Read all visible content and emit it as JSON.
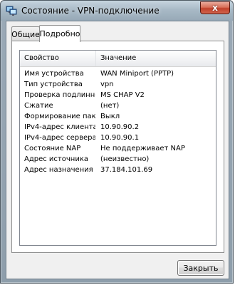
{
  "window": {
    "title": "Состояние - VPN-подключение",
    "close_glyph": "x",
    "app_icon": "network-connection-icon"
  },
  "tabs": [
    {
      "label": "Общие",
      "selected": false
    },
    {
      "label": "Подробно",
      "selected": true
    }
  ],
  "details": {
    "columns": {
      "property": "Свойство",
      "value": "Значение"
    },
    "rows": [
      {
        "property": "Имя устройства",
        "value": "WAN Miniport (PPTP)"
      },
      {
        "property": "Тип устройства",
        "value": "vpn"
      },
      {
        "property": "Проверка подлинности",
        "value": "MS CHAP V2"
      },
      {
        "property": "Сжатие",
        "value": "(нет)"
      },
      {
        "property": "Формирование паке...",
        "value": "Выкл"
      },
      {
        "property": "IPv4-адрес клиента",
        "value": "10.90.90.2"
      },
      {
        "property": "IPv4-адрес сервера",
        "value": "10.90.90.1"
      },
      {
        "property": "Состояние NAP",
        "value": "Не поддерживает NAP"
      },
      {
        "property": "Адрес источника",
        "value": "(неизвестно)"
      },
      {
        "property": "Адрес назначения",
        "value": "37.184.101.69"
      }
    ]
  },
  "buttons": {
    "close_label": "Закрыть"
  }
}
